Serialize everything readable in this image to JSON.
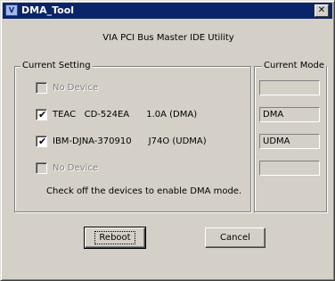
{
  "window": {
    "title": "DMA_Tool",
    "icon": "via-app-icon",
    "close_label": "✕"
  },
  "subtitle": "VIA PCI Bus Master IDE Utility",
  "current_setting": {
    "label": "Current Setting",
    "devices": [
      {
        "label": "No Device",
        "checked": false,
        "enabled": false
      },
      {
        "label": "TEAC   CD-524EA      1.0A (DMA)",
        "checked": true,
        "enabled": true
      },
      {
        "label": "IBM-DJNA-370910      J74O (UDMA)",
        "checked": true,
        "enabled": true
      },
      {
        "label": "No Device",
        "checked": false,
        "enabled": false
      }
    ],
    "note": "Check off the devices to enable DMA mode."
  },
  "current_mode": {
    "label": "Current Mode",
    "values": [
      "",
      "DMA",
      "UDMA",
      ""
    ]
  },
  "buttons": {
    "reboot": "Reboot",
    "cancel": "Cancel"
  },
  "colors": {
    "titlebar": "#0a246a",
    "face": "#d4d0c8"
  }
}
